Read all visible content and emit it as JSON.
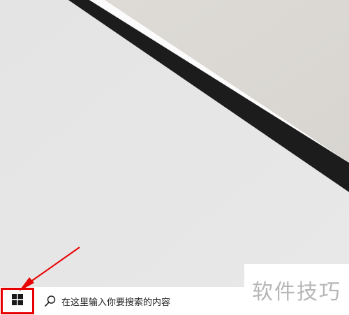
{
  "taskbar": {
    "start_icon": "windows-logo-icon",
    "search_icon": "search-icon",
    "search_placeholder": "在这里输入你要搜索的内容"
  },
  "watermark": {
    "text": "软件技巧"
  },
  "colors": {
    "annotation": "#e80000",
    "taskbar_bg": "#ffffff",
    "desktop_bg": "#e6e6e6",
    "diagonal_band": "#1c1c1c"
  }
}
